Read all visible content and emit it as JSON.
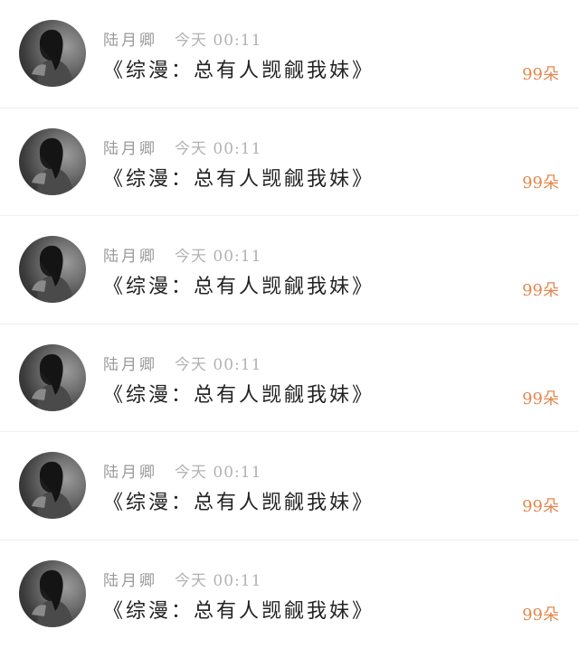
{
  "messages": [
    {
      "name": "陆月卿",
      "time": "今天 00:11",
      "title": "《综漫：总有人觊觎我妹》",
      "count": "99朵"
    },
    {
      "name": "陆月卿",
      "time": "今天 00:11",
      "title": "《综漫：总有人觊觎我妹》",
      "count": "99朵"
    },
    {
      "name": "陆月卿",
      "time": "今天 00:11",
      "title": "《综漫：总有人觊觎我妹》",
      "count": "99朵"
    },
    {
      "name": "陆月卿",
      "time": "今天 00:11",
      "title": "《综漫：总有人觊觎我妹》",
      "count": "99朵"
    },
    {
      "name": "陆月卿",
      "time": "今天 00:11",
      "title": "《综漫：总有人觊觎我妹》",
      "count": "99朵"
    },
    {
      "name": "陆月卿",
      "time": "今天 00:11",
      "title": "《综漫：总有人觊觎我妹》",
      "count": "99朵"
    }
  ],
  "avatar": {
    "icon": "user-avatar-photo",
    "colors": [
      "#262626",
      "#6e6e6e",
      "#9b9b9b"
    ]
  },
  "count_color": "#e3884f"
}
